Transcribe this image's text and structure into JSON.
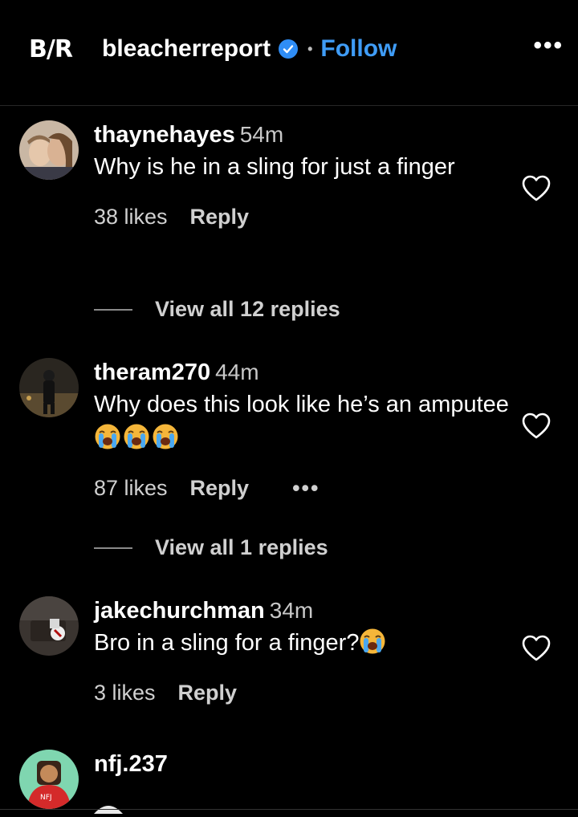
{
  "header": {
    "logo": "B/R",
    "account": "bleacherreport",
    "separator": "•",
    "follow_label": "Follow",
    "more": "•••"
  },
  "comments": [
    {
      "user": "thaynehayes",
      "time": "54m",
      "text": "Why is he in a sling for just a finger",
      "likes": "38 likes",
      "reply": "Reply",
      "view_replies": "View all 12 replies"
    },
    {
      "user": "theram270",
      "time": "44m",
      "text": "Why does this look like he’s an amputee",
      "likes": "87 likes",
      "reply": "Reply",
      "more": "•••",
      "view_replies": "View all 1 replies"
    },
    {
      "user": "jakechurchman",
      "time": "34m",
      "text": "Bro in a sling for a finger?",
      "likes": "3 likes",
      "reply": "Reply"
    },
    {
      "user": "nfj.237"
    }
  ],
  "icons": {
    "verified": "verified-badge-icon",
    "heart": "heart-outline-icon",
    "crying": "loudly-crying-face-emoji"
  },
  "colors": {
    "background": "#000000",
    "follow": "#3f9cf6",
    "verified": "#2f8df5"
  }
}
